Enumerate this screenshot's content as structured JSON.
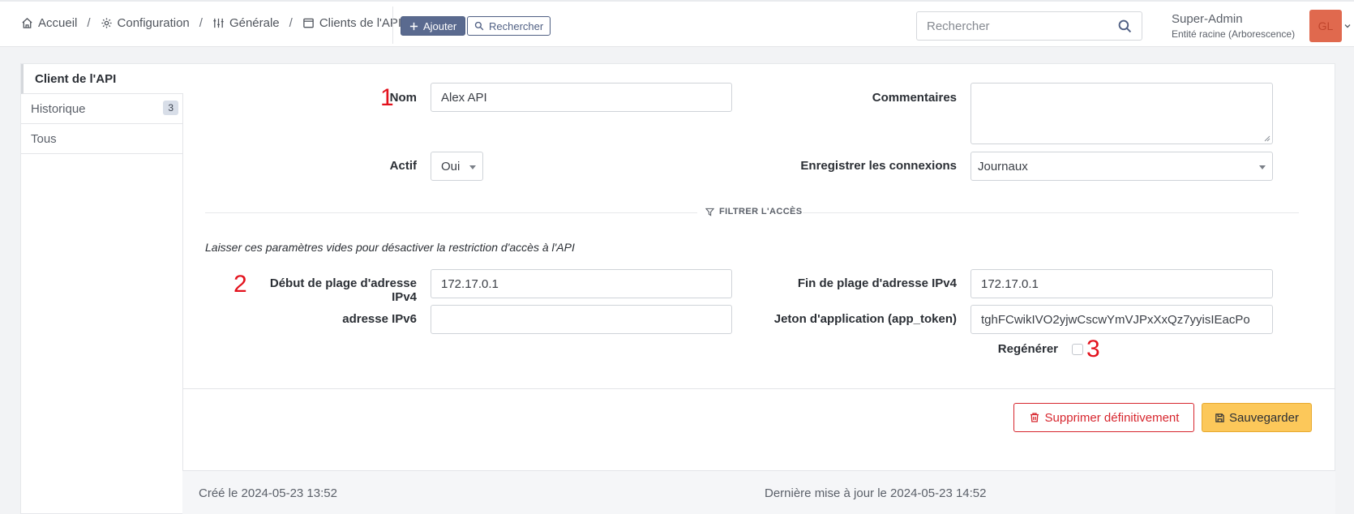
{
  "breadcrumb": [
    {
      "label": "Accueil",
      "icon": "home-icon"
    },
    {
      "label": "Configuration",
      "icon": "gear-icon"
    },
    {
      "label": "Générale",
      "icon": "sliders-icon"
    },
    {
      "label": "Clients de l'API",
      "icon": "window-icon"
    }
  ],
  "toolbar": {
    "add_label": "Ajouter",
    "search_label": "Rechercher"
  },
  "search": {
    "placeholder": "Rechercher"
  },
  "user": {
    "name": "Super-Admin",
    "entity": "Entité racine (Arborescence)",
    "initials": "GL",
    "avatar_color": "#e0694e"
  },
  "tabs": [
    {
      "label": "Client de l'API",
      "active": true
    },
    {
      "label": "Historique",
      "badge": "3"
    },
    {
      "label": "Tous"
    }
  ],
  "form": {
    "name_label": "Nom",
    "name_value": "Alex API",
    "comments_label": "Commentaires",
    "comments_value": "",
    "active_label": "Actif",
    "active_value": "Oui",
    "log_label": "Enregistrer les connexions",
    "log_value": "Journaux",
    "filter_title": "FILTRER L'ACCÈS",
    "hint": "Laisser ces paramètres vides pour désactiver la restriction d'accès à l'API",
    "ipv4_start_label": "Début de plage d'adresse IPv4",
    "ipv4_start_value": "172.17.0.1",
    "ipv4_end_label": "Fin de plage d'adresse IPv4",
    "ipv4_end_value": "172.17.0.1",
    "ipv6_label": "adresse IPv6",
    "ipv6_value": "",
    "token_label": "Jeton d'application (app_token)",
    "token_value": "tghFCwikIVO2yjwCscwYmVJPxXxQz7yyisIEacPo",
    "regen_label": "Regénérer"
  },
  "annotations": {
    "m1": "1",
    "m2": "2",
    "m3": "3"
  },
  "actions": {
    "delete_label": "Supprimer définitivement",
    "save_label": "Sauvegarder"
  },
  "footer": {
    "created": "Créé le 2024-05-23 13:52",
    "updated": "Dernière mise à jour le 2024-05-23 14:52"
  },
  "colors": {
    "accent": "#5a6a8f",
    "danger": "#d7262e",
    "save": "#fcc85a",
    "annotation": "#e3121d"
  }
}
